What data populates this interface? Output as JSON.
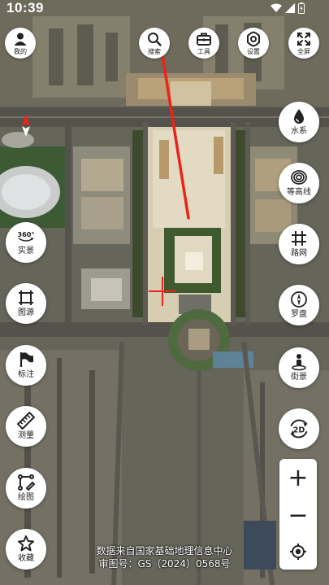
{
  "status_bar": {
    "time": "10:39"
  },
  "top_toolbar": [
    {
      "id": "mine",
      "label": "我的",
      "icon": "person-icon"
    },
    {
      "id": "search",
      "label": "搜索",
      "icon": "search-icon"
    },
    {
      "id": "tools",
      "label": "工具",
      "icon": "toolbox-icon"
    },
    {
      "id": "settings",
      "label": "设置",
      "icon": "gear-icon"
    },
    {
      "id": "fullscreen",
      "label": "全屏",
      "icon": "fullscreen-icon"
    }
  ],
  "left_tools": [
    {
      "id": "live-view",
      "label": "实景",
      "icon": "360-icon",
      "icon_text": "360°"
    },
    {
      "id": "layers",
      "label": "图源",
      "icon": "layers-icon"
    },
    {
      "id": "marker",
      "label": "标注",
      "icon": "flag-icon"
    },
    {
      "id": "measure",
      "label": "测量",
      "icon": "ruler-icon"
    },
    {
      "id": "draw",
      "label": "绘图",
      "icon": "draw-icon"
    },
    {
      "id": "favorites",
      "label": "收藏",
      "icon": "star-icon"
    }
  ],
  "right_tools": [
    {
      "id": "water",
      "label": "水系",
      "icon": "water-drop-icon"
    },
    {
      "id": "contour",
      "label": "等高线",
      "icon": "contour-icon"
    },
    {
      "id": "roads",
      "label": "路网",
      "icon": "road-network-icon"
    },
    {
      "id": "compass",
      "label": "罗盘",
      "icon": "compass-icon"
    },
    {
      "id": "street-view",
      "label": "街景",
      "icon": "street-view-icon"
    }
  ],
  "view_mode": {
    "label": "2D"
  },
  "zoom": {
    "in_label": "+",
    "out_label": "−",
    "locate_icon": "locate-icon"
  },
  "attribution": {
    "line1": "数据来自国家基础地理信息中心",
    "line2": "审图号：GS（2024）0568号"
  },
  "colors": {
    "annotation_line": "#e8241c",
    "crosshair": "#e8241c",
    "icon": "#222222"
  }
}
